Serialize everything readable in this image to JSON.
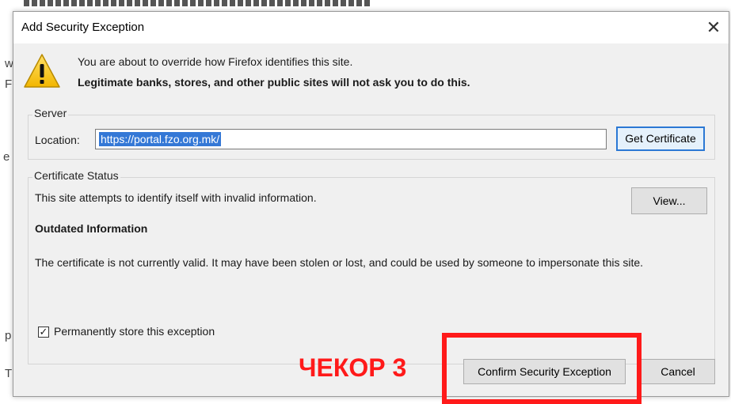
{
  "dialog": {
    "title": "Add Security Exception",
    "close_label": "✕",
    "warning_line1": "You are about to override how Firefox identifies this site.",
    "warning_line2": "Legitimate banks, stores, and other public sites will not ask you to do this."
  },
  "server": {
    "group_label": "Server",
    "location_label": "Location:",
    "location_value": "https://portal.fzo.org.mk/",
    "get_certificate_label": "Get Certificate"
  },
  "certificate_status": {
    "group_label": "Certificate Status",
    "status_text": "This site attempts to identify itself with invalid information.",
    "view_label": "View...",
    "outdated_heading": "Outdated Information",
    "outdated_text": "The certificate is not currently valid. It may have been stolen or lost, and could be used by someone to impersonate this site."
  },
  "permanent_store": {
    "checked": true,
    "label": "Permanently store this exception"
  },
  "buttons": {
    "confirm_label": "Confirm Security Exception",
    "cancel_label": "Cancel"
  },
  "annotation": {
    "text": "ЧЕКОР 3",
    "color": "#ff1a1a"
  },
  "colors": {
    "selection": "#3478d6",
    "focus_border": "#2b78d4"
  },
  "background_fragments": {
    "f1": "w",
    "f2": "F",
    "f3": "e",
    "f4": "p",
    "f5": "T"
  }
}
